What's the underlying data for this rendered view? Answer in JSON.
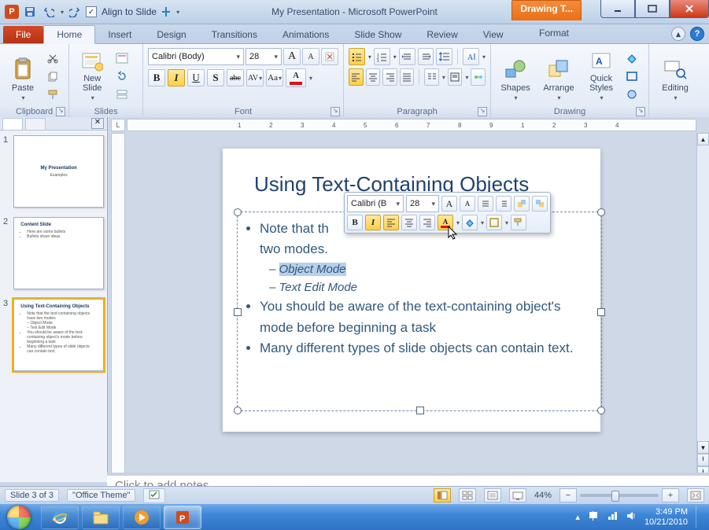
{
  "titlebar": {
    "title": "My Presentation  -  Microsoft PowerPoint",
    "context_tab": "Drawing T...",
    "align_label": "Align to Slide",
    "pp": "P"
  },
  "systray": {
    "time": "3:49 PM",
    "date": "10/21/2010"
  },
  "ribbon_tabs": {
    "file": "File",
    "home": "Home",
    "insert": "Insert",
    "design": "Design",
    "transitions": "Transitions",
    "animations": "Animations",
    "slideshow": "Slide Show",
    "review": "Review",
    "view": "View",
    "format": "Format"
  },
  "groups": {
    "clipboard": "Clipboard",
    "slides": "Slides",
    "font": "Font",
    "paragraph": "Paragraph",
    "drawing": "Drawing",
    "editing": "Editing"
  },
  "clipboard": {
    "paste": "Paste"
  },
  "slides": {
    "new_slide": "New\nSlide"
  },
  "font_group": {
    "name": "Calibri (Body)",
    "size": "28",
    "grow": "A",
    "shrink": "A",
    "bold": "B",
    "italic": "I",
    "underline": "U",
    "strike": "S",
    "abc": "abc",
    "shadow_av": "AV",
    "spacing_aa": "Aa",
    "clear": "A"
  },
  "drawing_group": {
    "shapes": "Shapes",
    "arrange": "Arrange",
    "quick_styles": "Quick\nStyles"
  },
  "editing_group": {
    "editing": "Editing"
  },
  "thumbs": {
    "s1": {
      "title": "My Presentation",
      "sub": "Examples"
    },
    "s2": {
      "title": "Content Slide",
      "b1": "Here are some bullets",
      "b2": "Bullets share ideas"
    },
    "s3": {
      "title": "Using Text-Containing Objects"
    }
  },
  "slide": {
    "title": "Using Text-Containing Objects",
    "b1a": "Note that th",
    "b1b": "two modes.",
    "sub1": "Object Mode",
    "sub2": "Text Edit Mode",
    "b2": "You should be aware of the text-containing object's mode before beginning a task",
    "b3": "Many different types of slide objects can contain text."
  },
  "mini_tb": {
    "font": "Calibri (B",
    "size": "28",
    "grow": "A",
    "shrink": "A",
    "bold": "B",
    "italic": "I"
  },
  "notes": {
    "placeholder": "Click to add notes"
  },
  "status": {
    "slide": "Slide 3 of 3",
    "theme": "\"Office Theme\"",
    "zoom": "44%"
  },
  "ruler_corner": "L"
}
